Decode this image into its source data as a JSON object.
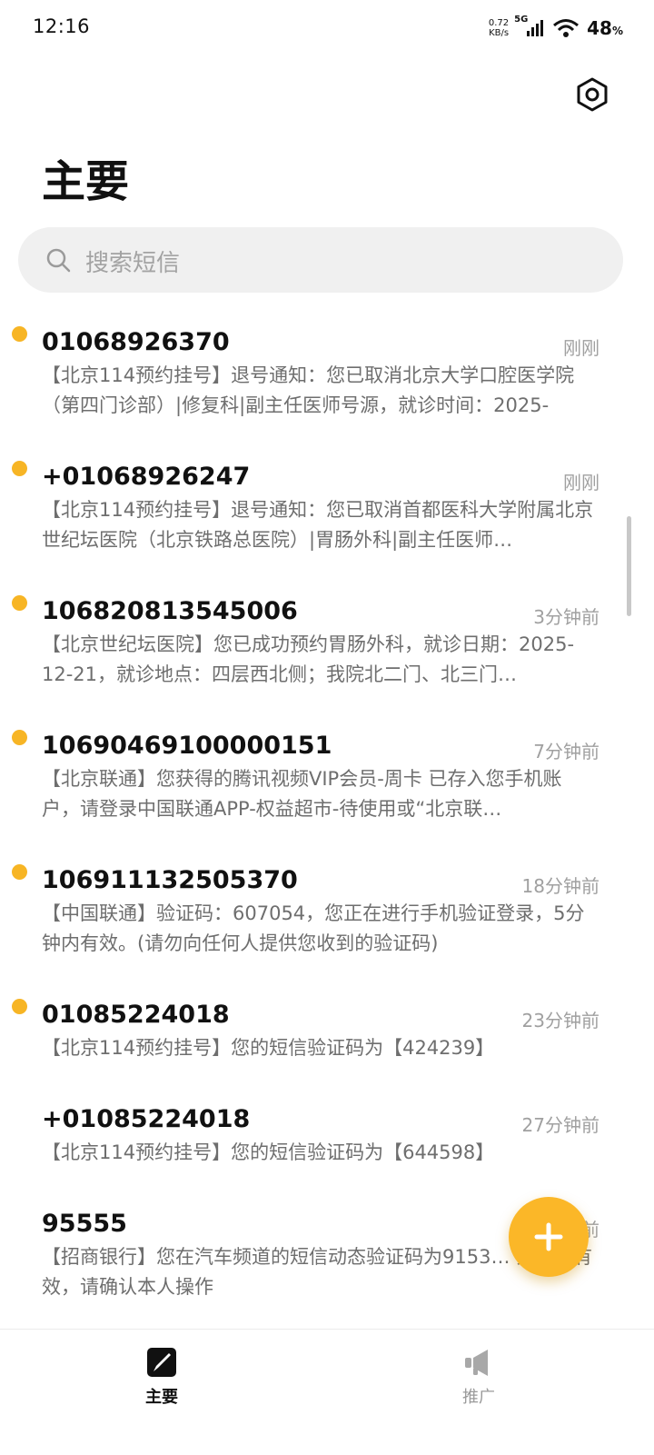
{
  "status_bar": {
    "time": "12:16",
    "net_speed_value": "0.72",
    "net_speed_unit": "KB/s",
    "network": "5G",
    "battery": "48",
    "battery_unit": "%",
    "icons": [
      "signal-icon",
      "wifi-icon"
    ]
  },
  "header": {
    "title": "主要",
    "settings_icon": "settings-icon"
  },
  "search": {
    "placeholder": "搜索短信",
    "icon": "search-icon"
  },
  "messages": [
    {
      "sender": "01068926370",
      "time": "刚刚",
      "unread": true,
      "preview": "【北京114预约挂号】退号通知：您已取消北京大学口腔医学院（第四门诊部）|修复科|副主任医师号源，就诊时间：2025-"
    },
    {
      "sender": "+01068926247",
      "time": "刚刚",
      "unread": true,
      "preview": "【北京114预约挂号】退号通知：您已取消首都医科大学附属北京世纪坛医院（北京铁路总医院）|胃肠外科|副主任医师…"
    },
    {
      "sender": "106820813545006",
      "time": "3分钟前",
      "unread": true,
      "preview": "【北京世纪坛医院】您已成功预约胃肠外科，就诊日期：2025-12-21，就诊地点：四层西北侧；我院北二门、北三门…"
    },
    {
      "sender": "10690469100000151",
      "time": "7分钟前",
      "unread": true,
      "preview": "【北京联通】您获得的腾讯视频VIP会员-周卡 已存入您手机账户，请登录中国联通APP-权益超市-待使用或“北京联…"
    },
    {
      "sender": "106911132505370",
      "time": "18分钟前",
      "unread": true,
      "preview": "【中国联通】验证码：607054，您正在进行手机验证登录，5分钟内有效。(请勿向任何人提供您收到的验证码)"
    },
    {
      "sender": "01085224018",
      "time": "23分钟前",
      "unread": true,
      "preview": "【北京114预约挂号】您的短信验证码为【424239】"
    },
    {
      "sender": "+01085224018",
      "time": "27分钟前",
      "unread": false,
      "preview": "【北京114预约挂号】您的短信验证码为【644598】"
    },
    {
      "sender": "95555",
      "time": "前",
      "unread": false,
      "preview": "【招商银行】您在汽车频道的短信动态验证码为9153… 分钟内有效，请确认本人操作"
    }
  ],
  "fab": {
    "icon": "plus-icon",
    "color": "#fbb728"
  },
  "bottom_nav": [
    {
      "label": "主要",
      "icon": "compose-icon",
      "active": true
    },
    {
      "label": "推广",
      "icon": "megaphone-icon",
      "active": false
    }
  ],
  "colors": {
    "accent": "#fbb728",
    "unread_dot": "#f7b525"
  }
}
